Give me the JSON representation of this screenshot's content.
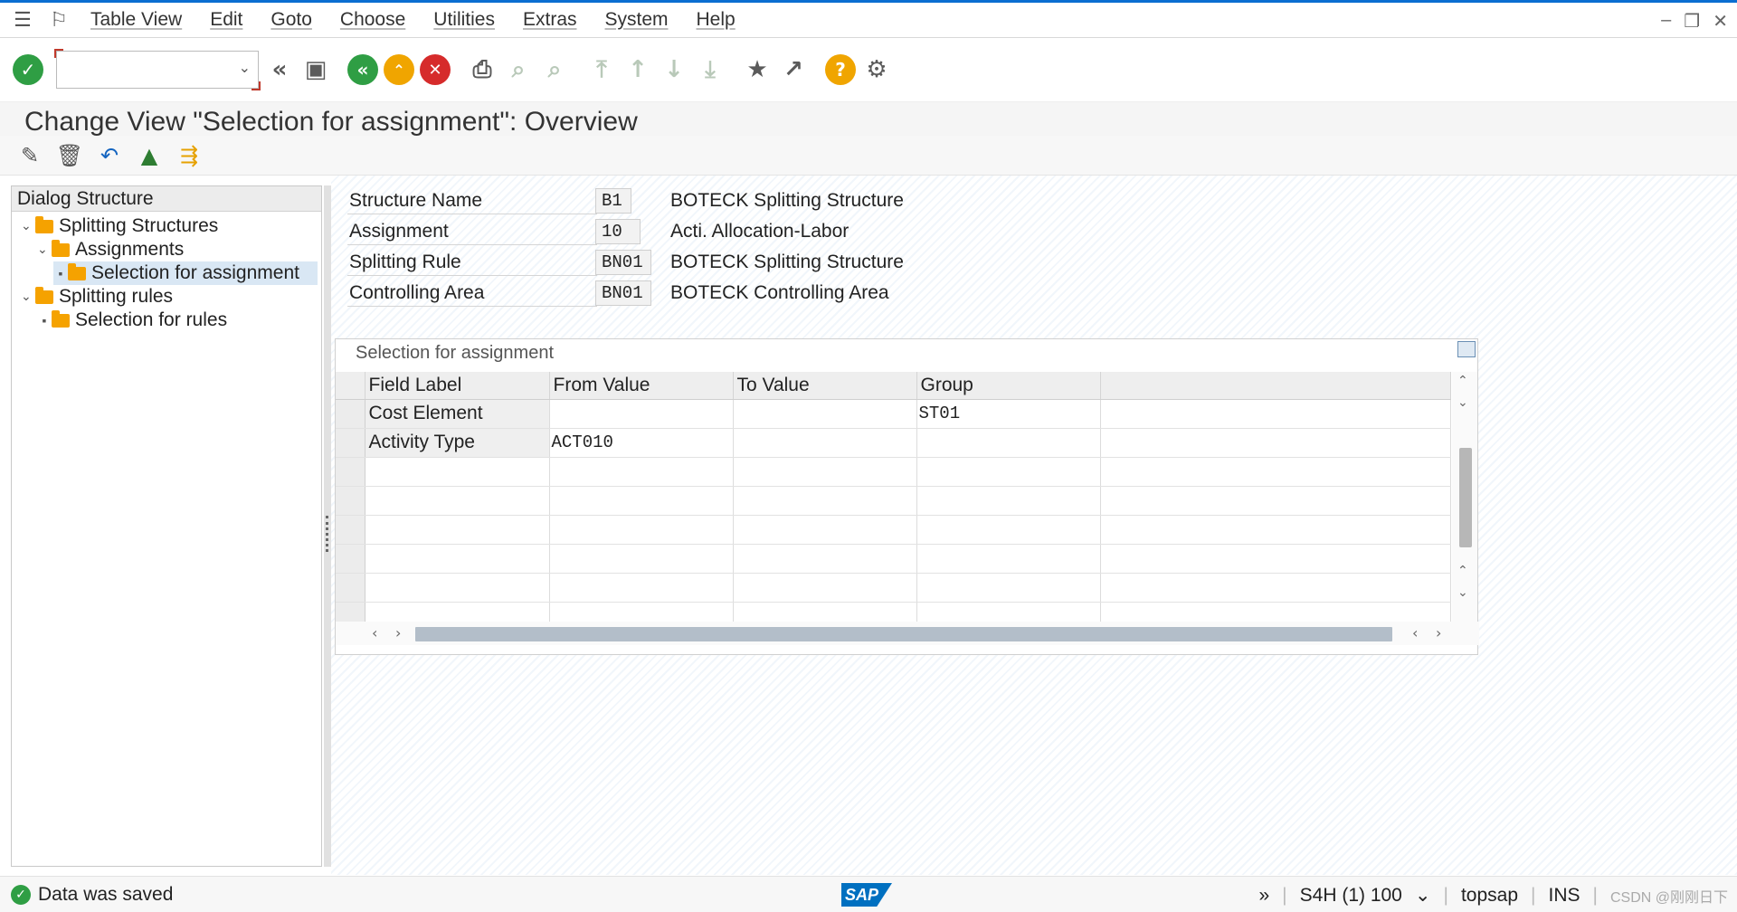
{
  "menubar": {
    "items": [
      "Table View",
      "Edit",
      "Goto",
      "Choose",
      "Utilities",
      "Extras",
      "System",
      "Help"
    ]
  },
  "toolbar": {
    "command_field_value": ""
  },
  "title": "Change View \"Selection for assignment\": Overview",
  "tree": {
    "header": "Dialog Structure",
    "nodes": [
      {
        "label": "Splitting Structures",
        "level": 1,
        "expanded": true,
        "selected": false
      },
      {
        "label": "Assignments",
        "level": 2,
        "expanded": true,
        "selected": false
      },
      {
        "label": "Selection for assignment",
        "level": 3,
        "expanded": false,
        "selected": true
      },
      {
        "label": "Splitting rules",
        "level": 1,
        "expanded": true,
        "selected": false
      },
      {
        "label": "Selection for rules",
        "level": 2,
        "expanded": false,
        "selected": false
      }
    ]
  },
  "header_fields": [
    {
      "label": "Structure Name",
      "value": "B1",
      "description": "BOTECK  Splitting Structure"
    },
    {
      "label": "Assignment",
      "value": "10",
      "description": "Acti. Allocation-Labor"
    },
    {
      "label": "Splitting Rule",
      "value": "BN01",
      "description": "BOTECK Splitting Structure"
    },
    {
      "label": "Controlling Area",
      "value": "BN01",
      "description": "BOTECK Controlling Area"
    }
  ],
  "table": {
    "title": "Selection for assignment",
    "columns": [
      "Field Label",
      "From Value",
      "To Value",
      "Group"
    ],
    "rows": [
      {
        "field_label": "Cost Element",
        "from_value": "",
        "to_value": "",
        "group": "ST01"
      },
      {
        "field_label": "Activity Type",
        "from_value": "ACT010",
        "to_value": "",
        "group": ""
      }
    ]
  },
  "status": {
    "message": "Data was saved",
    "system": "S4H (1) 100",
    "user": "topsap",
    "mode": "INS",
    "logo": "SAP",
    "watermark": "CSDN @刚刚日下"
  },
  "colors": {
    "accent": "#0a6ed1",
    "ok_green": "#2f9e44",
    "folder": "#f5a200",
    "selection": "#d9e7f4"
  }
}
